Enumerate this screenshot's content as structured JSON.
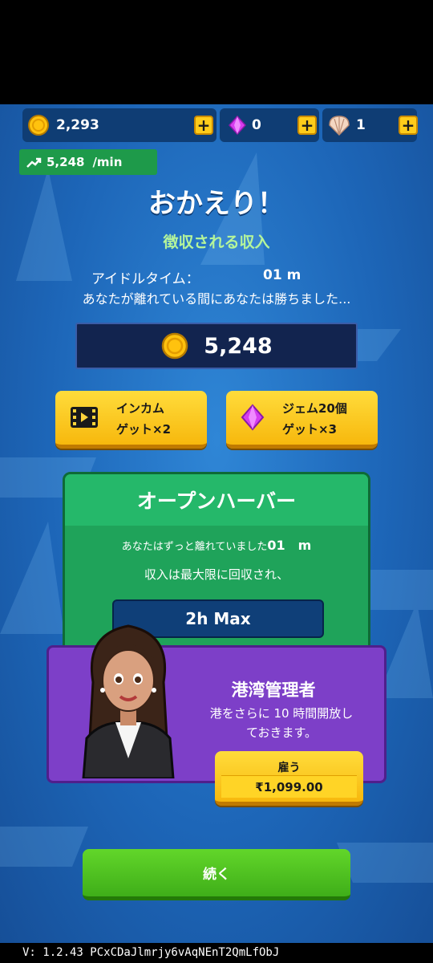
{
  "resources": {
    "coins": "2,293",
    "gems": "0",
    "shells": "1",
    "plus": "+"
  },
  "rate": {
    "value": "5,248",
    "unit": "/min"
  },
  "welcome": {
    "title": "おかえり！",
    "subtitle": "徴収される収入",
    "idle_label": "アイドルタイム：",
    "idle_value": "01  m",
    "won_text": "あなたが離れている間にあなたは勝ちました..."
  },
  "earnings": "5,248",
  "buttons": {
    "income_line1": "インカム",
    "income_line2": "ゲット×2",
    "gem_line1": "ジェム20個",
    "gem_line2": "ゲット×3",
    "continue": "続く"
  },
  "harbor": {
    "title": "オープンハーバー",
    "away_text": "あなたはずっと離れていました",
    "away_value": "01　m",
    "max_text": "収入は最大限に回収され、",
    "max_bar": "2h Max"
  },
  "manager": {
    "title": "港湾管理者",
    "desc_line1": "港をさらに 10 時間開放し",
    "desc_line2": "ておきます。",
    "hire_label": "雇う",
    "price": "₹1,099.00"
  },
  "version": "V: 1.2.43  PCxCDaJlmrjy6vAqNEnT2QmLfObJ",
  "colors": {
    "background": "#1d66b8",
    "coin": "#ffc20e",
    "gem": "#d63cf0",
    "panel_green": "#1fa35a",
    "offer_purple": "#7d3fc8",
    "continue_green": "#4cc21e"
  }
}
